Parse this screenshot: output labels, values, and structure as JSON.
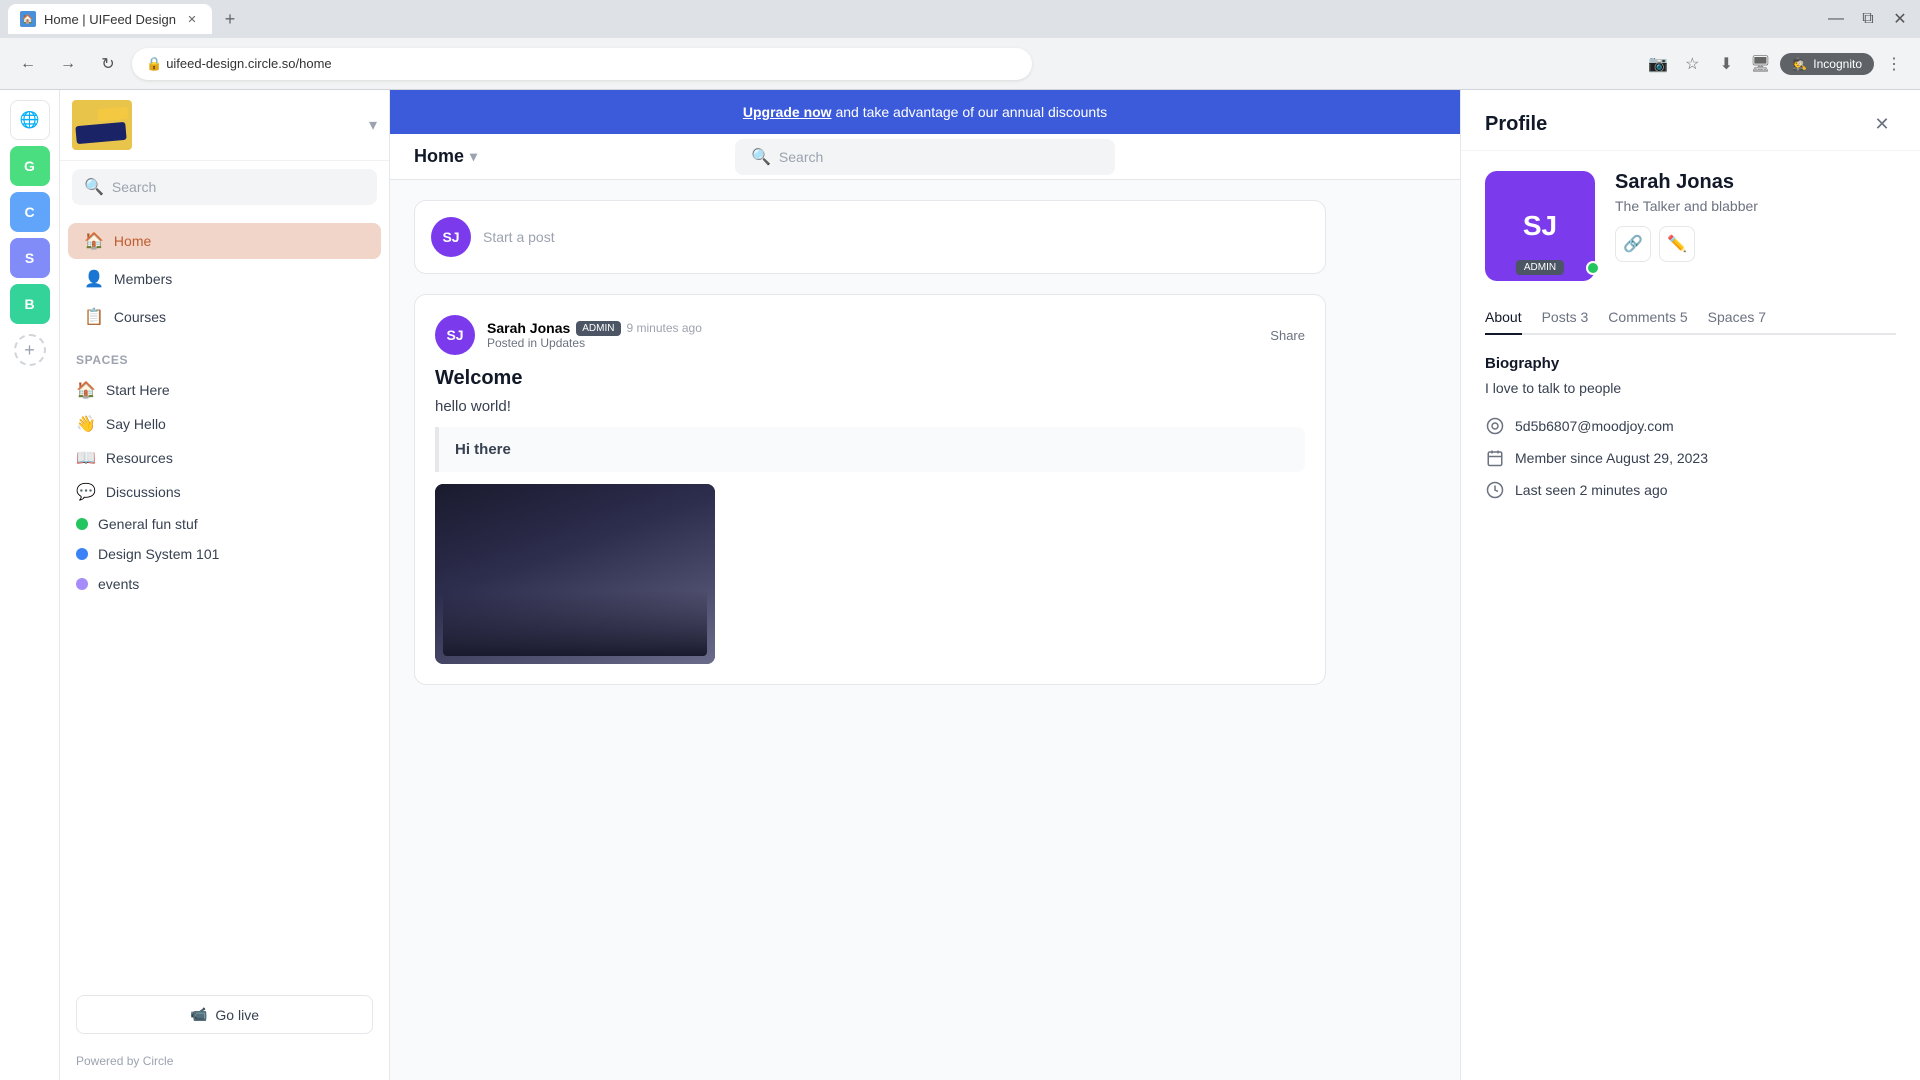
{
  "browser": {
    "tab_title": "Home | UIFeed Design",
    "tab_favicon": "🏠",
    "new_tab_label": "+",
    "address": "uifeed-design.circle.so/home",
    "incognito_label": "Incognito",
    "nav_back": "←",
    "nav_forward": "→",
    "nav_refresh": "↻"
  },
  "search": {
    "placeholder": "Search"
  },
  "upgrade_banner": {
    "link_text": "Upgrade now",
    "text": " and take advantage of our annual discounts"
  },
  "sidebar_icons": [
    {
      "id": "globe",
      "label": "🌐",
      "type": "globe"
    },
    {
      "id": "G",
      "label": "G",
      "type": "g-icon"
    },
    {
      "id": "C",
      "label": "C",
      "type": "c-icon"
    },
    {
      "id": "S",
      "label": "S",
      "type": "s-icon"
    },
    {
      "id": "B",
      "label": "B",
      "type": "b-icon"
    }
  ],
  "left_nav": {
    "logo_alt": "Business Logo",
    "nav_items": [
      {
        "id": "home",
        "label": "Home",
        "icon": "🏠",
        "active": true
      },
      {
        "id": "members",
        "label": "Members",
        "icon": "👤",
        "active": false
      },
      {
        "id": "courses",
        "label": "Courses",
        "icon": "📋",
        "active": false
      }
    ],
    "spaces_label": "Spaces",
    "spaces": [
      {
        "id": "start-here",
        "label": "Start Here",
        "icon": "🏠",
        "dot_type": null
      },
      {
        "id": "say-hello",
        "label": "Say Hello",
        "icon": "👋",
        "dot_type": null
      },
      {
        "id": "resources",
        "label": "Resources",
        "icon": "📖",
        "dot_type": null
      },
      {
        "id": "discussions",
        "label": "Discussions",
        "icon": "💬",
        "dot_type": null
      },
      {
        "id": "general-fun",
        "label": "General fun stuf",
        "icon": null,
        "dot_type": "green"
      },
      {
        "id": "design-system",
        "label": "Design System 101",
        "icon": null,
        "dot_type": "blue"
      },
      {
        "id": "events",
        "label": "events",
        "icon": null,
        "dot_type": "purple"
      }
    ],
    "go_live_label": "Go live",
    "powered_by": "Powered by Circle"
  },
  "main": {
    "home_title": "Home",
    "composer_placeholder": "Start a post",
    "composer_avatar": "SJ",
    "post": {
      "author": "Sarah Jonas",
      "admin_badge": "ADMIN",
      "time": "9 minutes ago",
      "location": "Posted in Updates",
      "share_label": "Shar...",
      "title": "Welcome",
      "body": "hello world!",
      "quote": "Hi there"
    }
  },
  "profile": {
    "panel_title": "Profile",
    "avatar_initials": "SJ",
    "name": "Sarah Jonas",
    "tagline": "The Talker and blabber",
    "admin_badge": "ADMIN",
    "tabs": [
      {
        "id": "about",
        "label": "About",
        "count": null,
        "active": true
      },
      {
        "id": "posts",
        "label": "Posts",
        "count": "3",
        "active": false
      },
      {
        "id": "comments",
        "label": "Comments",
        "count": "5",
        "active": false
      },
      {
        "id": "spaces",
        "label": "Spaces",
        "count": "7",
        "active": false
      }
    ],
    "biography_label": "Biography",
    "biography_text": "I love to talk to people",
    "details": [
      {
        "id": "email",
        "icon": "🔘",
        "text": "5d5b6807@moodjoy.com"
      },
      {
        "id": "member-since",
        "icon": "📅",
        "text": "Member since August 29, 2023"
      },
      {
        "id": "last-seen",
        "icon": "🕐",
        "text": "Last seen 2 minutes ago"
      }
    ]
  }
}
